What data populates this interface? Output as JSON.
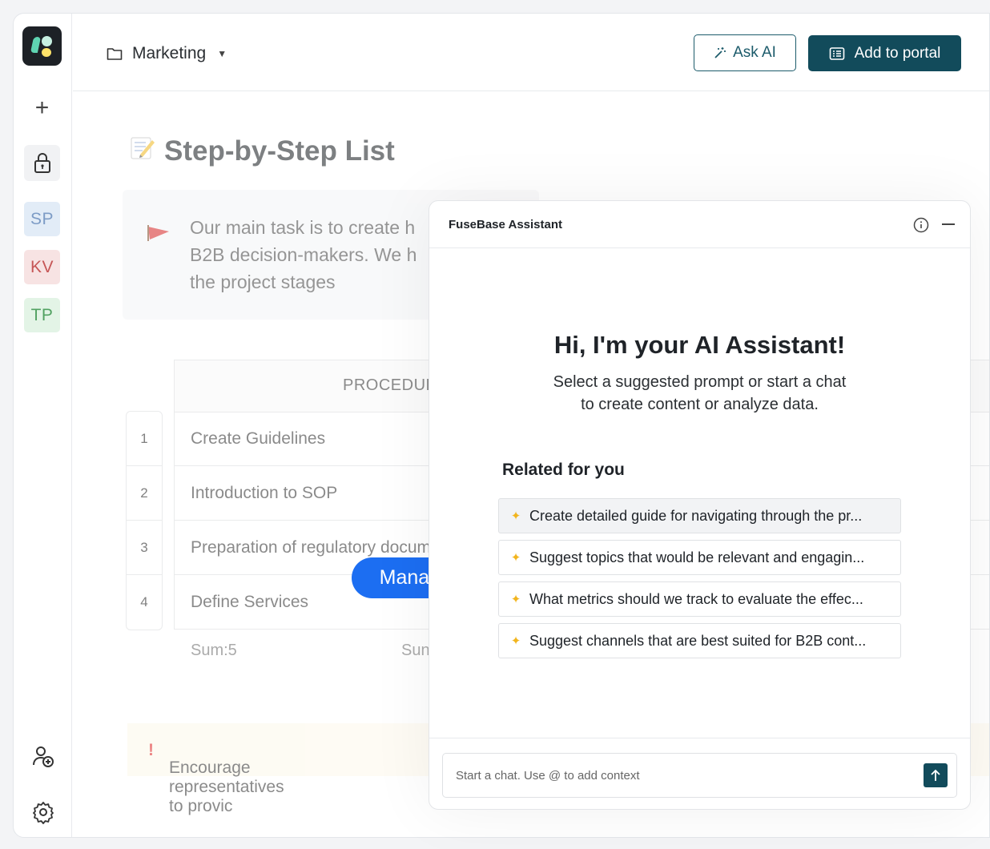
{
  "header": {
    "breadcrumb": "Marketing",
    "ask_ai_label": "Ask AI",
    "add_portal_label": "Add to portal"
  },
  "sidebar": {
    "avatars": [
      {
        "initials": "SP",
        "color": "#7d9cc6"
      },
      {
        "initials": "KV",
        "color": "#c65656"
      },
      {
        "initials": "TP",
        "color": "#52a262"
      }
    ]
  },
  "page": {
    "title": "Step-by-Step List",
    "callout_lines": [
      "Our main task is to create h",
      "B2B decision-makers. We h",
      "the project stages"
    ],
    "table": {
      "header": "PROCEDUR",
      "rows": [
        {
          "num": "1",
          "label": "Create Guidelines"
        },
        {
          "num": "2",
          "label": "Introduction to SOP"
        },
        {
          "num": "3",
          "label": "Preparation of regulatory docum"
        },
        {
          "num": "4",
          "label": "Define Services"
        }
      ],
      "sum_1": "Sum:5",
      "sum_2": "Sun"
    },
    "warning": "Encourage representatives to provic"
  },
  "assistant": {
    "title": "FuseBase Assistant",
    "greeting": "Hi, I'm your AI Assistant!",
    "subtitle_line1": "Select a suggested prompt or start a chat",
    "subtitle_line2": "to create content or analyze data.",
    "related_heading": "Related for you",
    "suggestions": [
      "Create detailed guide for navigating through the pr...",
      "Suggest topics that would be relevant and engagin...",
      "What metrics should we track to evaluate the effec...",
      "Suggest channels that are best suited for B2B cont..."
    ],
    "chat_placeholder": "Start a chat. Use @ to add context"
  },
  "cursor_label": "Manager",
  "colors": {
    "brand": "#124b5b",
    "cursor": "#1c6ef2",
    "spark": "#f2b51e"
  }
}
